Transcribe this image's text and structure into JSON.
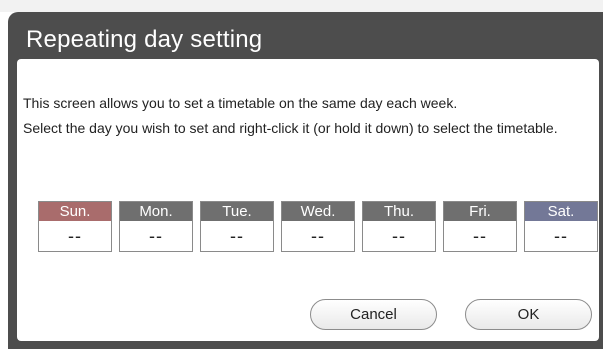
{
  "dialog": {
    "title": "Repeating day setting",
    "description": [
      "This screen allows you to set a timetable on the same day each week.",
      "Select the day you wish to set and right-click it (or hold it down) to select the timetable."
    ]
  },
  "days": [
    {
      "label": "Sun.",
      "value": "--",
      "header_color": "#a96c6c"
    },
    {
      "label": "Mon.",
      "value": "--",
      "header_color": "#6f6f6f"
    },
    {
      "label": "Tue.",
      "value": "--",
      "header_color": "#6f6f6f"
    },
    {
      "label": "Wed.",
      "value": "--",
      "header_color": "#6f6f6f"
    },
    {
      "label": "Thu.",
      "value": "--",
      "header_color": "#6f6f6f"
    },
    {
      "label": "Fri.",
      "value": "--",
      "header_color": "#6f6f6f"
    },
    {
      "label": "Sat.",
      "value": "--",
      "header_color": "#737897"
    }
  ],
  "buttons": {
    "cancel": "Cancel",
    "ok": "OK"
  }
}
